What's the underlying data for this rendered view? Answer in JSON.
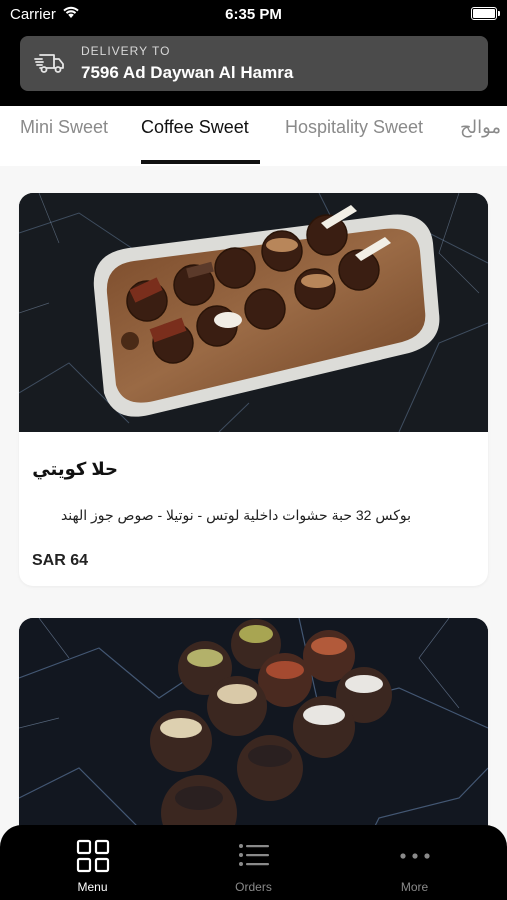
{
  "status": {
    "carrier": "Carrier",
    "time": "6:35 PM"
  },
  "delivery": {
    "label": "DELIVERY TO",
    "address": "7596 Ad Daywan Al Hamra"
  },
  "tabs": [
    {
      "label": "Mini Sweet",
      "active": false
    },
    {
      "label": "Coffee Sweet",
      "active": true
    },
    {
      "label": "Hospitality Sweet",
      "active": false
    },
    {
      "label": "موالح",
      "active": false
    }
  ],
  "products": [
    {
      "name": "حلا كويتي",
      "description": "بوكس 32 حبة حشوات داخلية  لوتس - نوتيلا - صوص جوز الهند",
      "price": "SAR 64"
    },
    {
      "name": "",
      "description": "",
      "price": ""
    }
  ],
  "bottom_nav": [
    {
      "label": "Menu",
      "icon": "grid-icon",
      "active": true
    },
    {
      "label": "Orders",
      "icon": "list-icon",
      "active": false
    },
    {
      "label": "More",
      "icon": "more-dots-icon",
      "active": false
    }
  ],
  "colors": {
    "header_bg": "#000000",
    "delivery_bg": "#4b4b4b",
    "page_bg": "#f7f7f7",
    "active_tab": "#111111",
    "inactive": "#8a8a8a"
  }
}
